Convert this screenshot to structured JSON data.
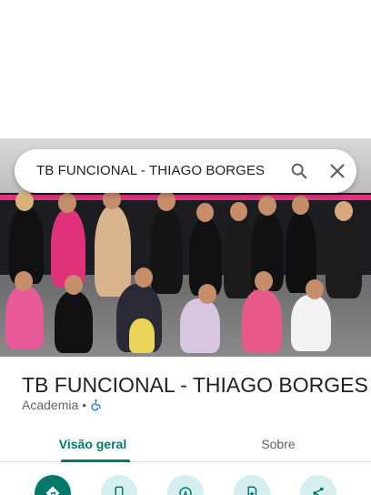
{
  "search": {
    "query": "TB FUNCIONAL - THIAGO BORGES"
  },
  "place": {
    "title": "TB FUNCIONAL - THIAGO BORGES",
    "category": "Academia",
    "separator": "•"
  },
  "tabs": [
    {
      "label": "Visão geral",
      "active": true
    },
    {
      "label": "Sobre",
      "active": false
    }
  ],
  "actions": [
    {
      "icon": "directions-icon"
    },
    {
      "icon": "phone-icon"
    },
    {
      "icon": "navigation-start-icon"
    },
    {
      "icon": "save-icon"
    },
    {
      "icon": "share-icon"
    }
  ],
  "colors": {
    "accent": "#00796b",
    "accent_light": "#d4efed",
    "wall_stripe": "#e0327a"
  }
}
